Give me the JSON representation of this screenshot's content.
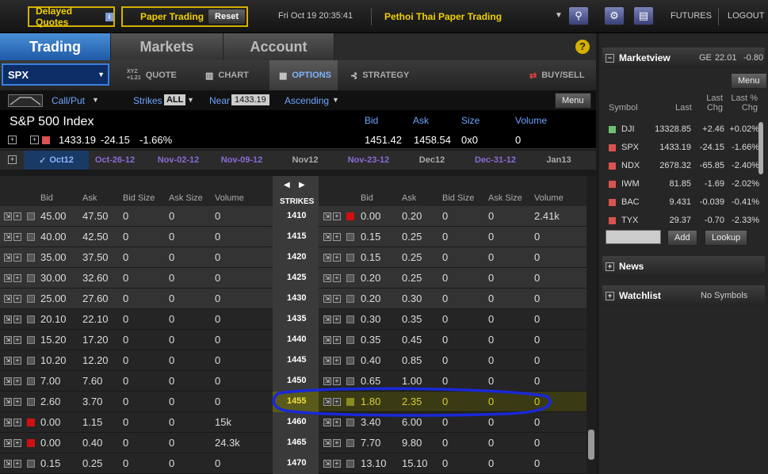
{
  "topbar": {
    "delayed_label": "Delayed Quotes",
    "paper_label": "Paper Trading",
    "reset_label": "Reset",
    "datetime": "Fri Oct 19 20:35:41",
    "account_name": "Pethoi Thai Paper Trading",
    "futures": "FUTURES",
    "logout": "LOGOUT"
  },
  "tabs": [
    "Trading",
    "Markets",
    "Account"
  ],
  "help": "?",
  "toolbar": {
    "symbol": "SPX",
    "quote_icon_top": "XYZ",
    "quote_icon_bottom": "+1.21",
    "quote": "QUOTE",
    "chart": "CHART",
    "options": "OPTIONS",
    "strategy": "STRATEGY",
    "buysell": "BUY/SELL"
  },
  "filters": {
    "callput": "Call/Put",
    "strikes_label": "Strikes",
    "strikes_value": "ALL",
    "near_label": "Near",
    "near_value": "1433.19",
    "order": "Ascending",
    "menu": "Menu"
  },
  "index": {
    "name": "S&P 500 Index",
    "last": "1433.19",
    "change": "-24.15",
    "pct": "-1.66%",
    "hdr_bid": "Bid",
    "hdr_ask": "Ask",
    "hdr_size": "Size",
    "hdr_volume": "Volume",
    "bid": "1451.42",
    "ask": "1458.54",
    "size": "0x0",
    "volume": "0"
  },
  "expirations": [
    "Oct12",
    "Oct-26-12",
    "Nov-02-12",
    "Nov-09-12",
    "Nov12",
    "Nov-23-12",
    "Dec12",
    "Dec-31-12",
    "Jan13"
  ],
  "chain": {
    "headers": {
      "bid": "Bid",
      "ask": "Ask",
      "bid_size": "Bid Size",
      "ask_size": "Ask Size",
      "volume": "Volume",
      "strikes": "STRIKES"
    },
    "rows": [
      {
        "strike": "1410",
        "c": [
          "45.00",
          "47.50",
          "0",
          "0",
          "0"
        ],
        "p": [
          "0.00",
          "0.20",
          "0",
          "0",
          "2.41k"
        ],
        "cred": false,
        "pred": true
      },
      {
        "strike": "1415",
        "c": [
          "40.00",
          "42.50",
          "0",
          "0",
          "0"
        ],
        "p": [
          "0.15",
          "0.25",
          "0",
          "0",
          "0"
        ],
        "cred": false,
        "pred": false
      },
      {
        "strike": "1420",
        "c": [
          "35.00",
          "37.50",
          "0",
          "0",
          "0"
        ],
        "p": [
          "0.15",
          "0.25",
          "0",
          "0",
          "0"
        ],
        "cred": false,
        "pred": false
      },
      {
        "strike": "1425",
        "c": [
          "30.00",
          "32.60",
          "0",
          "0",
          "0"
        ],
        "p": [
          "0.20",
          "0.25",
          "0",
          "0",
          "0"
        ],
        "cred": false,
        "pred": false
      },
      {
        "strike": "1430",
        "c": [
          "25.00",
          "27.60",
          "0",
          "0",
          "0"
        ],
        "p": [
          "0.20",
          "0.30",
          "0",
          "0",
          "0"
        ],
        "cred": false,
        "pred": false
      },
      {
        "strike": "1435",
        "c": [
          "20.10",
          "22.10",
          "0",
          "0",
          "0"
        ],
        "p": [
          "0.30",
          "0.35",
          "0",
          "0",
          "0"
        ],
        "cred": false,
        "pred": false
      },
      {
        "strike": "1440",
        "c": [
          "15.20",
          "17.20",
          "0",
          "0",
          "0"
        ],
        "p": [
          "0.35",
          "0.45",
          "0",
          "0",
          "0"
        ],
        "cred": false,
        "pred": false
      },
      {
        "strike": "1445",
        "c": [
          "10.20",
          "12.20",
          "0",
          "0",
          "0"
        ],
        "p": [
          "0.40",
          "0.85",
          "0",
          "0",
          "0"
        ],
        "cred": false,
        "pred": false
      },
      {
        "strike": "1450",
        "c": [
          "7.00",
          "7.60",
          "0",
          "0",
          "0"
        ],
        "p": [
          "0.65",
          "1.00",
          "0",
          "0",
          "0"
        ],
        "cred": false,
        "pred": false
      },
      {
        "strike": "1455",
        "c": [
          "2.60",
          "3.70",
          "0",
          "0",
          "0"
        ],
        "p": [
          "1.80",
          "2.35",
          "0",
          "0",
          "0"
        ],
        "cred": false,
        "pred": false,
        "hl": true
      },
      {
        "strike": "1460",
        "c": [
          "0.00",
          "1.15",
          "0",
          "0",
          "15k"
        ],
        "p": [
          "3.40",
          "6.00",
          "0",
          "0",
          "0"
        ],
        "cred": true,
        "pred": false
      },
      {
        "strike": "1465",
        "c": [
          "0.00",
          "0.40",
          "0",
          "0",
          "24.3k"
        ],
        "p": [
          "7.70",
          "9.80",
          "0",
          "0",
          "0"
        ],
        "cred": true,
        "pred": false
      },
      {
        "strike": "1470",
        "c": [
          "0.15",
          "0.25",
          "0",
          "0",
          "0"
        ],
        "p": [
          "13.10",
          "15.10",
          "0",
          "0",
          "0"
        ],
        "cred": false,
        "pred": false
      }
    ]
  },
  "marketview": {
    "title": "Marketview",
    "ge_label": "GE",
    "ge_value": "22.01",
    "ge_change": "-0.80",
    "menu": "Menu",
    "hdr_symbol": "Symbol",
    "hdr_last": "Last",
    "hdr_lastchg_1": "Last",
    "hdr_lastchg_2": "Chg",
    "hdr_lastpct_1": "Last %",
    "hdr_lastpct_2": "Chg",
    "rows": [
      {
        "sym": "DJI",
        "last": "13328.85",
        "chg": "+2.46",
        "pct": "+0.02%",
        "color": "#6fbf73"
      },
      {
        "sym": "SPX",
        "last": "1433.19",
        "chg": "-24.15",
        "pct": "-1.66%",
        "color": "#d9534f"
      },
      {
        "sym": "NDX",
        "last": "2678.32",
        "chg": "-65.85",
        "pct": "-2.40%",
        "color": "#d9534f"
      },
      {
        "sym": "IWM",
        "last": "81.85",
        "chg": "-1.69",
        "pct": "-2.02%",
        "color": "#d9534f"
      },
      {
        "sym": "BAC",
        "last": "9.431",
        "chg": "-0.039",
        "pct": "-0.41%",
        "color": "#d9534f"
      },
      {
        "sym": "TYX",
        "last": "29.37",
        "chg": "-0.70",
        "pct": "-2.33%",
        "color": "#d9534f"
      }
    ],
    "add": "Add",
    "lookup": "Lookup"
  },
  "news": {
    "title": "News"
  },
  "watchlist": {
    "title": "Watchlist",
    "status": "No Symbols"
  }
}
